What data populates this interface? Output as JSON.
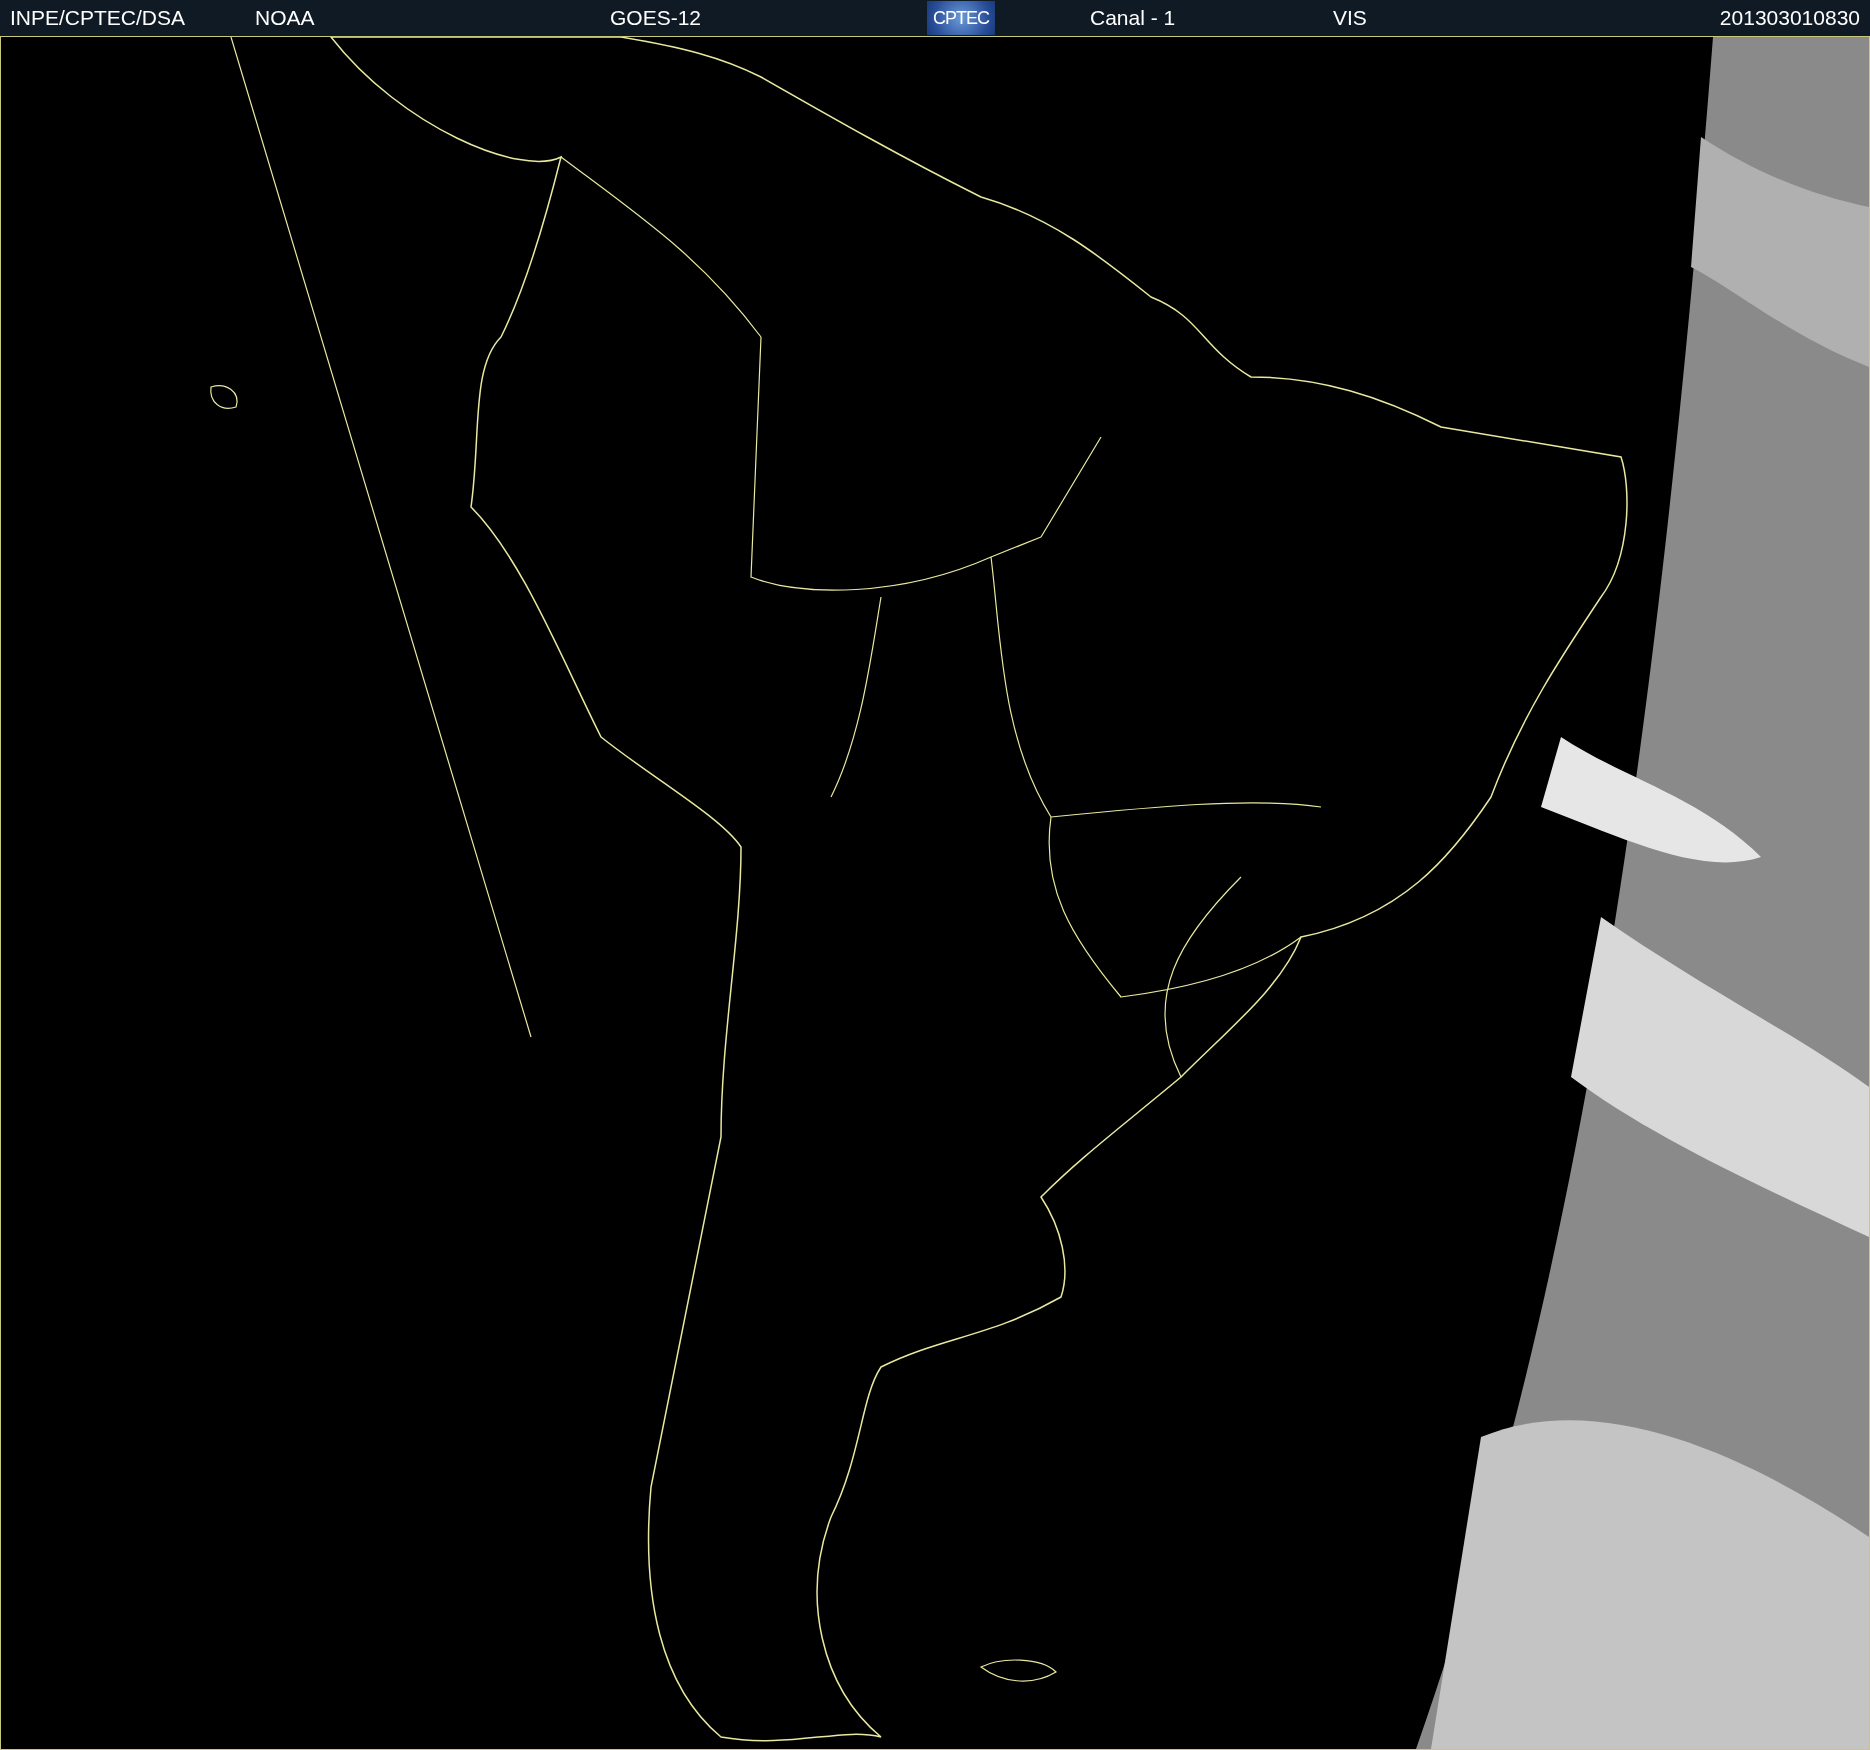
{
  "header": {
    "items": [
      {
        "kind": "text",
        "label": "INPE/CPTEC/DSA"
      },
      {
        "kind": "text",
        "label": "NOAA"
      },
      {
        "kind": "text",
        "label": "GOES-12"
      },
      {
        "kind": "logo",
        "label": "CPTEC"
      },
      {
        "kind": "text",
        "label": "Canal - 1"
      },
      {
        "kind": "text",
        "label": "VIS"
      },
      {
        "kind": "text",
        "label": "201303010830"
      }
    ]
  }
}
